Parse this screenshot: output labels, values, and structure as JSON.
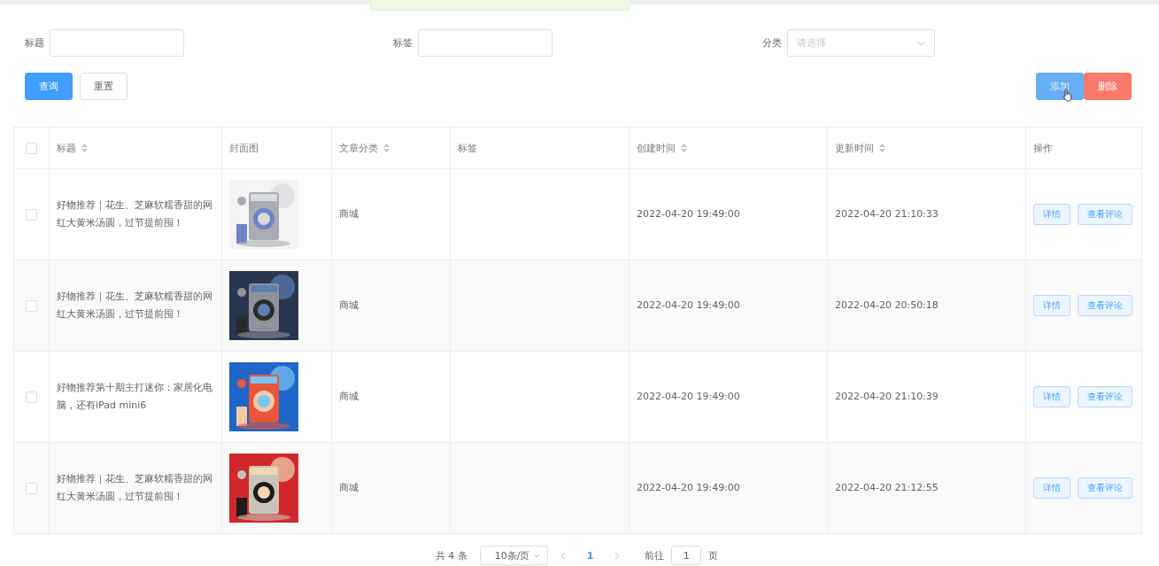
{
  "filters": [
    {
      "label": "标题",
      "kind": "input"
    },
    {
      "label": "标签",
      "kind": "input"
    },
    {
      "label": "分类",
      "kind": "select",
      "placeholder": "请选择"
    }
  ],
  "left_buttons": [
    {
      "label": "查询",
      "kind": "primary"
    },
    {
      "label": "重置",
      "kind": "plain"
    }
  ],
  "right_buttons": [
    {
      "label": "添加",
      "kind": "add"
    },
    {
      "label": "删除",
      "kind": "danger"
    }
  ],
  "table": {
    "all_selected": false,
    "columns": [
      {
        "label": "标题",
        "sortable": true
      },
      {
        "label": "封面图",
        "sortable": false
      },
      {
        "label": "文章分类",
        "sortable": true
      },
      {
        "label": "标签",
        "sortable": false
      },
      {
        "label": "创建时间",
        "sortable": true
      },
      {
        "label": "更新时间",
        "sortable": true
      },
      {
        "label": "操作",
        "sortable": false
      }
    ],
    "rows": [
      {
        "selected": false,
        "title": "好物推荐｜花生、芝麻软糯香甜的网红大黄米汤圆，过节提前囤！",
        "cover": {
          "kind": "picture"
        },
        "category": "商城",
        "created": "2022-04-20 19:49:00",
        "updated": "2022-04-20 21:10:33",
        "actions": [
          "详情",
          "查看评论"
        ]
      },
      {
        "selected": false,
        "title": "好物推荐｜花生、芝麻软糯香甜的网红大黄米汤圆，过节提前囤！",
        "cover": {
          "kind": "picture"
        },
        "category": "商城",
        "created": "2022-04-20 19:49:00",
        "updated": "2022-04-20 20:50:18",
        "actions": [
          "详情",
          "查看评论"
        ]
      },
      {
        "selected": false,
        "title": "好物推荐第十期主打迷你：家居化电脑，还有iPad mini6",
        "cover": {
          "kind": "picture"
        },
        "category": "商城",
        "created": "2022-04-20 19:49:00",
        "updated": "2022-04-20 21:10:39",
        "actions": [
          "详情",
          "查看评论"
        ]
      },
      {
        "selected": false,
        "title": "好物推荐｜花生、芝麻软糯香甜的网红大黄米汤圆，过节提前囤！",
        "cover": {
          "kind": "picture"
        },
        "category": "商城",
        "created": "2022-04-20 19:49:00",
        "updated": "2022-04-20 21:12:55",
        "actions": [
          "详情",
          "查看评论"
        ]
      }
    ]
  },
  "pagination": {
    "total": "共 4 条",
    "page_size": "10条/页",
    "pages": [
      {
        "label": "1",
        "selected": true
      }
    ],
    "goto_label": "前往",
    "goto_value": "1",
    "page_unit": "页"
  }
}
